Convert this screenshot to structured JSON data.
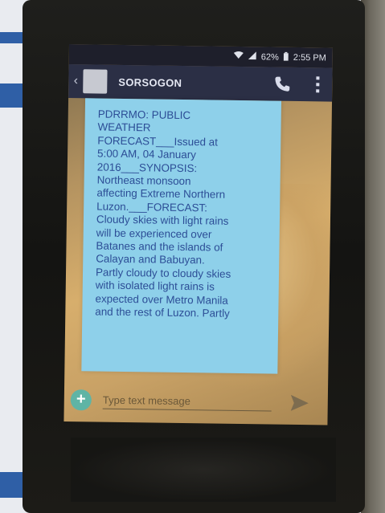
{
  "status_bar": {
    "battery": "62%",
    "time": "2:55 PM"
  },
  "conversation": {
    "contact": "SORSOGON"
  },
  "message": {
    "text": "PDRRMO: PUBLIC\nWEATHER\nFORECAST___Issued at\n5:00 AM, 04 January\n2016___SYNOPSIS:\nNortheast monsoon\naffecting Extreme Northern\nLuzon.___FORECAST:\nCloudy skies with light rains\nwill be experienced over\nBatanes and the islands of\nCalayan and Babuyan.\nPartly cloudy to cloudy skies\nwith isolated light rains is\nexpected over Metro Manila\nand the rest of Luzon. Partly"
  },
  "composer": {
    "placeholder": "Type text message"
  },
  "colors": {
    "header": "#2b2f45",
    "bubble": "#8ed0ea",
    "bubble_text": "#2c4d96",
    "plus_button": "#5fb4a5"
  },
  "icons": {
    "back": "back-arrow-icon",
    "call": "phone-icon",
    "menu": "overflow-menu-icon",
    "add": "plus-icon",
    "send": "send-icon",
    "wifi": "wifi-icon",
    "signal": "signal-icon",
    "battery": "battery-icon"
  }
}
